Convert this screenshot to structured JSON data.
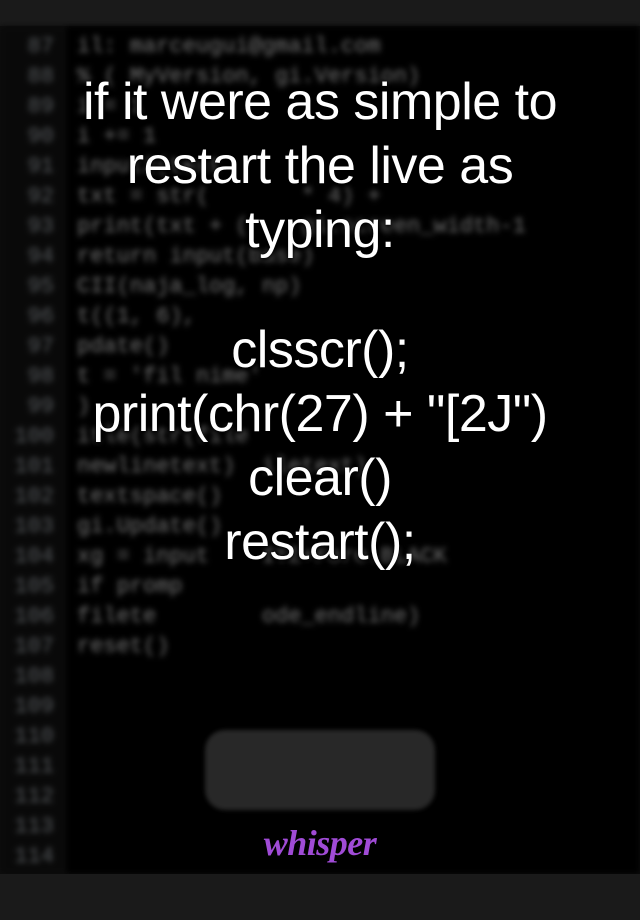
{
  "code_background": {
    "line_numbers": [
      87,
      88,
      89,
      90,
      91,
      92,
      93,
      94,
      95,
      96,
      97,
      98,
      99,
      100,
      101,
      102,
      103,
      104,
      105,
      106,
      107,
      108,
      109,
      110,
      111,
      112,
      113,
      114
    ],
    "lines": [
      "il: marceugui@gmail.com",
      "% ( MyVersion, gi.Version)",
      "",
      "",
      "",
      "i = 1",
      "",
      "i += 1",
      "input2(text",
      "txt = str(       * 4) +",
      "print(txt + (    gi.screen_width-1",
      "return input(base)",
      "",
      "CII(naja_log, np)",
      "t((1, 6),",
      "pdate()",
      "t = 'fil nime'",
      ")",
      "itle(str(file",
      "newlinetext)  iletext)",
      "textspace()",
      "gi.Update()",
      "xg = input    ITE+Fore.BLACK",
      "if promp",
      "filete        ode_endline)",
      "reset()"
    ]
  },
  "overlay": {
    "line1": "if it were as simple to",
    "line2": "restart the live as",
    "line3": "typing:",
    "line4": "clsscr();",
    "line5": "print(chr(27) + \"[2J\")",
    "line6": "clear()",
    "line7": "restart();"
  },
  "brand": "whisper"
}
